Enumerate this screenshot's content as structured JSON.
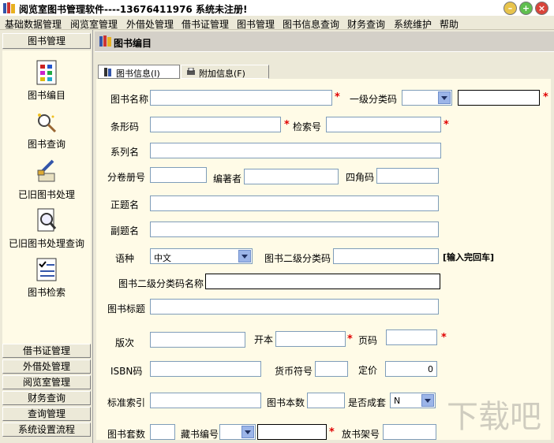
{
  "window": {
    "title": "阅览室图书管理软件----13676411976  系统未注册!",
    "colors": {
      "minimize": "#e8c44c",
      "maximize": "#5fbf4f",
      "close": "#d9443a"
    }
  },
  "menu": [
    "基础数据管理",
    "阅览室管理",
    "外借处管理",
    "借书证管理",
    "图书管理",
    "图书信息查询",
    "财务查询",
    "系统维护",
    "帮助"
  ],
  "sidebar": {
    "header": "图书管理",
    "items": [
      "图书编目",
      "图书查询",
      "已旧图书处理",
      "已旧图书处理查询",
      "图书检索"
    ],
    "buttons": [
      "借书证管理",
      "外借处管理",
      "阅览室管理",
      "财务查询",
      "查询管理",
      "系统设置流程"
    ]
  },
  "main": {
    "header": "图书编目",
    "tabs": [
      "图书信息(I)",
      "附加信息(F)"
    ]
  },
  "form": {
    "book_name_label": "图书名称",
    "book_name_value": "",
    "class1_label": "一级分类码",
    "class1_value": "",
    "barcode_label": "条形码",
    "index_label": "检索号",
    "series_label": "系列名",
    "volume_label": "分卷册号",
    "editor_label": "编著者",
    "fourcorner_label": "四角码",
    "main_title_label": "正题名",
    "sub_title_label": "副题名",
    "language_label": "语种",
    "language_value": "中文",
    "class2_label": "图书二级分类码",
    "enter_hint": "[输入完回车]",
    "class2_name_label": "图书二级分类码名称",
    "book_title_label": "图书标题",
    "edition_label": "版次",
    "format_label": "开本",
    "pages_label": "页码",
    "isbn_label": "ISBN码",
    "currency_label": "货币符号",
    "price_label": "定价",
    "price_value": "0",
    "standard_index_label": "标准索引",
    "copies_label": "图书本数",
    "is_set_label": "是否成套",
    "is_set_value": "N",
    "set_count_label": "图书套数",
    "collection_label": "藏书编号",
    "shelf_label": "放书架号"
  }
}
